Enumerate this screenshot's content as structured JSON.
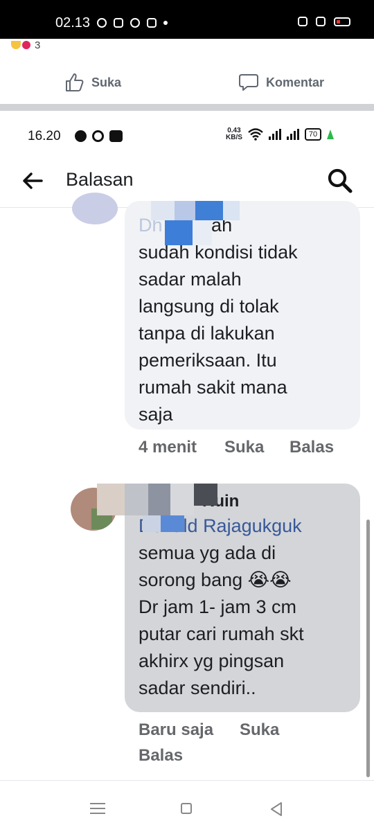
{
  "outer_status": {
    "time": "02.13"
  },
  "prev_post": {
    "reaction_count": "3",
    "like_label": "Suka",
    "comment_label": "Komentar"
  },
  "inner_status": {
    "time": "16.20",
    "net_speed": "0.43",
    "net_unit": "KB/S",
    "battery": "70"
  },
  "header": {
    "title": "Balasan"
  },
  "comments": [
    {
      "author_tag": "Dh   uin",
      "text": " wah\nsudah kondisi tidak\nsadar malah\nlangsung di tolak\ntanpa di lakukan\npemeriksaan. Itu\nrumah sakit mana\nsaja",
      "time": "4 menit",
      "like": "Suka",
      "reply": "Balas"
    },
    {
      "author_name": "Ruin",
      "mention": "Donald Rajagukguk",
      "text": "semua yg ada di\nsorong bang 😭😭\nDr jam 1- jam 3 cm\nputar cari rumah skt\nakhirx yg pingsan\nsadar sendiri..",
      "time": "Baru saja",
      "like": "Suka",
      "reply": "Balas"
    }
  ],
  "colors": {
    "accent_blue": "#385898",
    "meta_grey": "#65676b",
    "bubble_light": "#f0f2f5",
    "bubble_grey": "#d3d5d9"
  }
}
